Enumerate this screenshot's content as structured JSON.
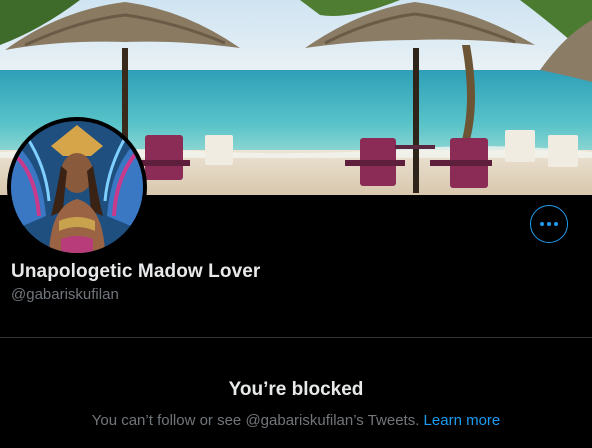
{
  "profile": {
    "display_name": "Unapologetic Madow Lover",
    "handle": "@gabariskufilan"
  },
  "more_button": {
    "icon": "more-horizontal-icon"
  },
  "blocked": {
    "title": "You’re blocked",
    "message": "You can’t follow or see @gabariskufilan’s Tweets.",
    "learn_more": "Learn more"
  },
  "colors": {
    "background": "#000000",
    "accent": "#1d9bf0",
    "primary_text": "#e7e9ea",
    "secondary_text": "#71767b",
    "divider": "#2f3336"
  }
}
